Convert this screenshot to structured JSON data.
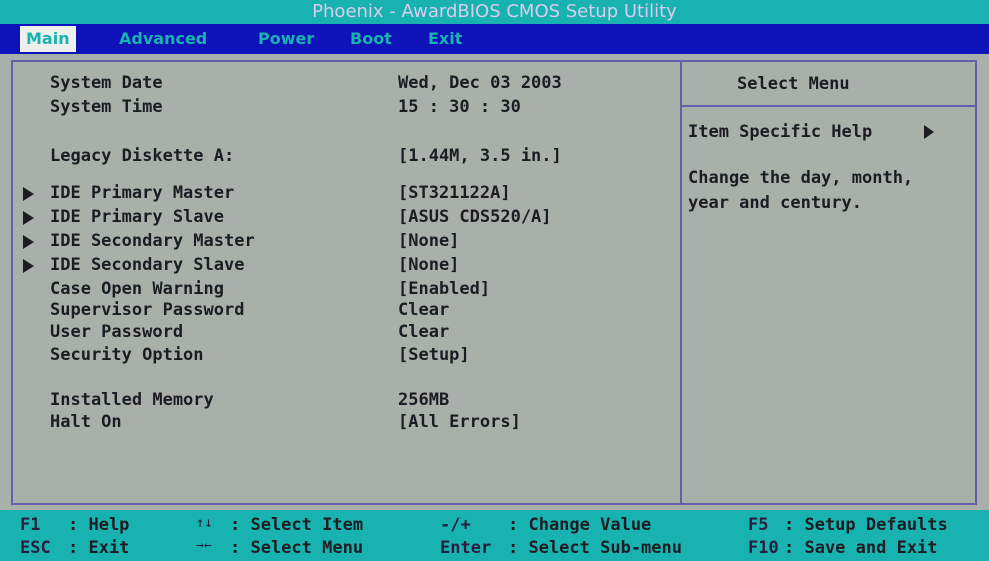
{
  "title": "Phoenix - AwardBIOS CMOS Setup Utility",
  "menu": [
    {
      "label": "Main",
      "active": true
    },
    {
      "label": "Advanced",
      "active": false
    },
    {
      "label": "Power",
      "active": false
    },
    {
      "label": "Boot",
      "active": false
    },
    {
      "label": "Exit",
      "active": false
    }
  ],
  "settings": [
    {
      "label": "System Date",
      "value": "Wed, Dec 03 2003"
    },
    {
      "label": "System Time",
      "value": "15 : 30 : 30"
    },
    {
      "label": "Legacy Diskette A:",
      "value": "[1.44M, 3.5 in.]"
    },
    {
      "label": "IDE Primary Master",
      "value": "[ST321122A]",
      "submenu": true
    },
    {
      "label": "IDE Primary Slave",
      "value": "[ASUS CDS520/A]",
      "submenu": true
    },
    {
      "label": "IDE Secondary Master",
      "value": "[None]",
      "submenu": true
    },
    {
      "label": "IDE Secondary Slave",
      "value": "[None]",
      "submenu": true
    },
    {
      "label": "Case Open Warning",
      "value": "[Enabled]"
    },
    {
      "label": "Supervisor Password",
      "value": "Clear"
    },
    {
      "label": "User Password",
      "value": "Clear"
    },
    {
      "label": "Security Option",
      "value": "[Setup]"
    },
    {
      "label": "Installed Memory",
      "value": "256MB"
    },
    {
      "label": "Halt On",
      "value": "[All Errors]"
    }
  ],
  "help": {
    "title": "Select Menu",
    "item_specific": "Item Specific Help",
    "text": "Change the day, month,\nyear and century."
  },
  "footer": [
    {
      "key": "F1",
      "desc": ": Help"
    },
    {
      "key": "↑↓",
      "desc": ": Select Item"
    },
    {
      "key": "-/+",
      "desc": ": Change Value"
    },
    {
      "key": "F5",
      "desc": ": Setup Defaults"
    },
    {
      "key": "ESC",
      "desc": ": Exit"
    },
    {
      "key": "→←",
      "desc": ": Select Menu"
    },
    {
      "key": "Enter",
      "desc": ": Select Sub-menu"
    },
    {
      "key": "F10",
      "desc": ": Save and Exit"
    }
  ],
  "colors": {
    "background": "#a9b0aa",
    "title_bar": "#18b3b0",
    "menu_bar": "#0d13b8",
    "frame": "#6360a8",
    "text": "#1c1c22"
  }
}
